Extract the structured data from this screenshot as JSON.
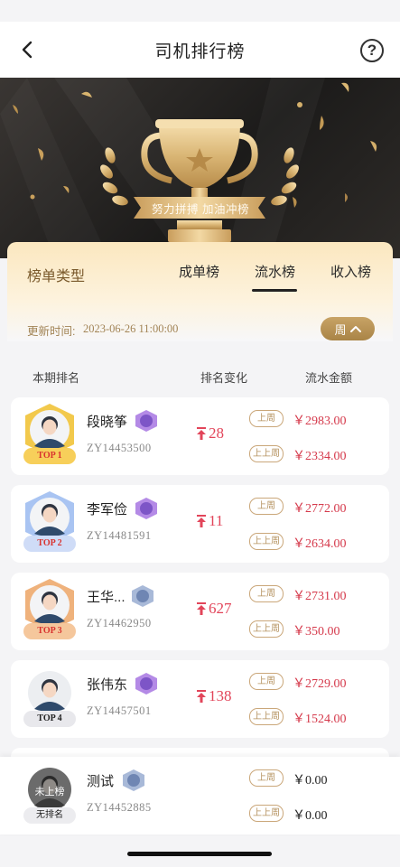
{
  "nav": {
    "title": "司机排行榜",
    "help_label": "?"
  },
  "banner": {
    "slogan": "努力拼搏 加油冲榜"
  },
  "panel": {
    "board_type_label": "榜单类型",
    "tabs": [
      {
        "label": "成单榜",
        "active": false
      },
      {
        "label": "流水榜",
        "active": true
      },
      {
        "label": "收入榜",
        "active": false
      }
    ],
    "update_label": "更新时间:",
    "update_time": "2023-06-26 11:00:00",
    "period_label": "周"
  },
  "columns": {
    "rank": "本期排名",
    "change": "排名变化",
    "amount": "流水金额"
  },
  "rows": [
    {
      "name": "段晓筝",
      "id": "ZY14453500",
      "badge": "TOP 1",
      "change": "28",
      "this_label": "上周",
      "this_amount": "￥2983.00",
      "prev_label": "上上周",
      "prev_amount": "￥2334.00"
    },
    {
      "name": "李军俭",
      "id": "ZY14481591",
      "badge": "TOP 2",
      "change": "11",
      "this_label": "上周",
      "this_amount": "￥2772.00",
      "prev_label": "上上周",
      "prev_amount": "￥2634.00"
    },
    {
      "name": "王华...",
      "id": "ZY14462950",
      "badge": "TOP 3",
      "change": "627",
      "this_label": "上周",
      "this_amount": "￥2731.00",
      "prev_label": "上上周",
      "prev_amount": "￥350.00"
    },
    {
      "name": "张伟东",
      "id": "ZY14457501",
      "badge": "TOP 4",
      "change": "138",
      "this_label": "上周",
      "this_amount": "￥2729.00",
      "prev_label": "上上周",
      "prev_amount": "￥1524.00"
    }
  ],
  "self_row": {
    "name": "测试",
    "id": "ZY14452885",
    "avatar_text": "未上榜",
    "badge": "无排名",
    "this_label": "上周",
    "this_amount": "￥0.00",
    "prev_label": "上上周",
    "prev_amount": "￥0.00"
  },
  "colors": {
    "gold": "#b8945c",
    "red": "#e2455a",
    "banner_dark": "#1c1b1a"
  }
}
